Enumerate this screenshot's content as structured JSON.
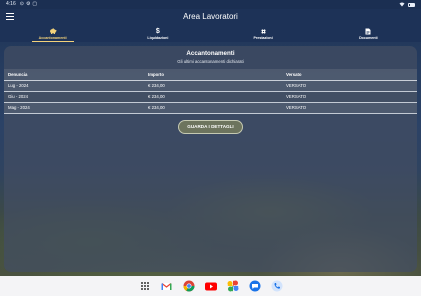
{
  "status_bar": {
    "time": "4:16",
    "icons": [
      "⊙",
      "⚙",
      "▢"
    ]
  },
  "app_bar": {
    "title": "Area Lavoratori"
  },
  "tabs": [
    {
      "label": "Accantonamenti",
      "icon": "piggy-bank-icon",
      "glyph": "🐷",
      "active": true
    },
    {
      "label": "Liquidazioni",
      "icon": "dollar-icon",
      "glyph": "$",
      "active": false
    },
    {
      "label": "Prestazioni",
      "icon": "bandage-icon",
      "glyph": "✚",
      "active": false
    },
    {
      "label": "Documenti",
      "icon": "document-icon",
      "glyph": "▤",
      "active": false
    }
  ],
  "card": {
    "title": "Accantonamenti",
    "subtitle": "Gli ultimi accantonamenti dichiarati",
    "columns": [
      "Denuncia",
      "Importo",
      "Versato"
    ],
    "rows": [
      [
        "Lug - 2024",
        "€ 234,00",
        "VERSATO"
      ],
      [
        "Giu - 2024",
        "€ 234,00",
        "VERSATO"
      ],
      [
        "Mag - 2024",
        "€ 234,00",
        "VERSATO"
      ]
    ],
    "details_button": "GUARDA I DETTAGLI"
  },
  "dock": {
    "apps": [
      "apps-grid-icon",
      "gmail-icon",
      "chrome-icon",
      "youtube-icon",
      "photos-icon",
      "messages-icon",
      "phone-icon"
    ]
  },
  "colors": {
    "accent": "#f3d27a",
    "app_bar": "#1d3257",
    "card": "#424e62"
  }
}
